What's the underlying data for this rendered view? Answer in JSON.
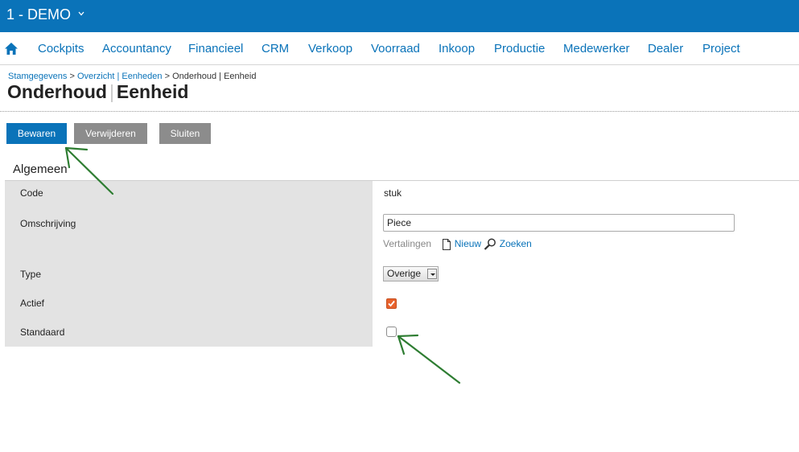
{
  "header": {
    "company": "1 - DEMO"
  },
  "nav": {
    "items": [
      "Cockpits",
      "Accountancy",
      "Financieel",
      "CRM",
      "Verkoop",
      "Voorraad",
      "Inkoop",
      "Productie",
      "Medewerker",
      "Dealer",
      "Project"
    ]
  },
  "breadcrumb": {
    "link1": "Stamgegevens",
    "sep1": " > ",
    "link2": "Overzicht | Eenheden",
    "sep2": " > ",
    "current": "Onderhoud | Eenheid"
  },
  "page": {
    "title_part1": "Onderhoud",
    "title_sep": "|",
    "title_part2": "Eenheid"
  },
  "toolbar": {
    "save": "Bewaren",
    "delete": "Verwijderen",
    "close": "Sluiten"
  },
  "form": {
    "section": "Algemeen",
    "code_label": "Code",
    "code_value": "stuk",
    "desc_label": "Omschrijving",
    "desc_value": "Piece",
    "translations_label": "Vertalingen",
    "new_label": "Nieuw",
    "search_label": "Zoeken",
    "type_label": "Type",
    "type_value": "Overige",
    "active_label": "Actief",
    "active_checked": true,
    "default_label": "Standaard",
    "default_checked": false
  },
  "colors": {
    "brand": "#0a73b9",
    "checkbox": "#e8622d",
    "annotation": "#2e7d32"
  },
  "icons": {
    "home": "home-icon",
    "chevron": "chevron-down-icon",
    "new": "document-icon",
    "search": "magnifier-icon"
  }
}
